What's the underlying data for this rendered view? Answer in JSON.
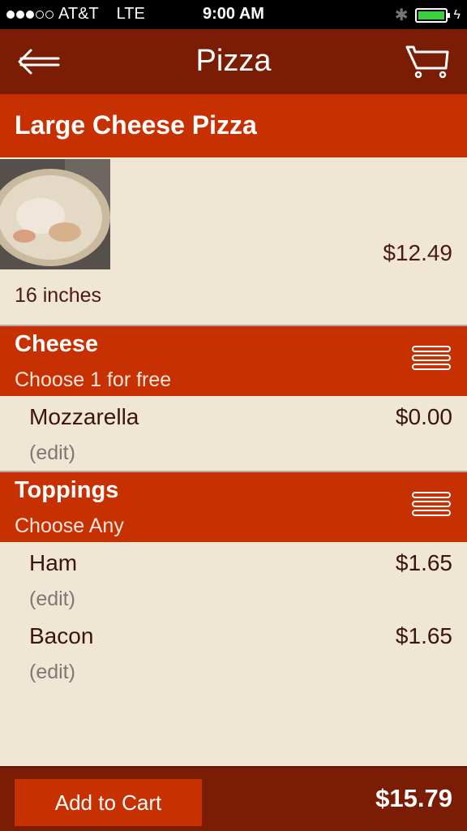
{
  "status_bar": {
    "carrier": "AT&T",
    "network": "LTE",
    "time": "9:00 AM"
  },
  "nav": {
    "title": "Pizza"
  },
  "item": {
    "name": "Large Cheese Pizza",
    "price": "$12.49",
    "size": "16 inches"
  },
  "groups": [
    {
      "title": "Cheese",
      "subtitle": "Choose 1 for free",
      "options": [
        {
          "name": "Mozzarella",
          "price": "$0.00",
          "edit": "(edit)"
        }
      ]
    },
    {
      "title": "Toppings",
      "subtitle": "Choose Any",
      "options": [
        {
          "name": "Ham",
          "price": "$1.65",
          "edit": "(edit)"
        },
        {
          "name": "Bacon",
          "price": "$1.65",
          "edit": "(edit)"
        }
      ]
    }
  ],
  "footer": {
    "add_to_cart_label": "Add to Cart",
    "total": "$15.79"
  },
  "colors": {
    "header_dark": "#7a1d04",
    "header_red": "#c73000",
    "background": "#efe7d3"
  }
}
